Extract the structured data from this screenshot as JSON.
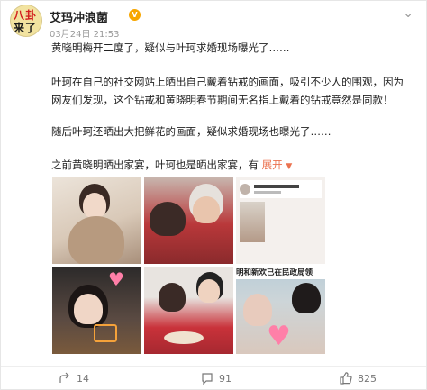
{
  "author": {
    "name": "艾玛冲浪菌",
    "avatar_line1": "八卦",
    "avatar_line2": "来了",
    "date": "03月24日 21:53"
  },
  "post": {
    "p1": "黄晓明梅开二度了，疑似与叶珂求婚现场曝光了……",
    "p2": "叶珂在自己的社交网站上晒出自己戴着钻戒的画面，吸引不少人的围观，因为网友们发现，这个钻戒和黄晓明春节期间无名指上戴着的钻戒竟然是同款！",
    "p3": "随后叶珂还晒出大把鲜花的画面，疑似求婚现场也曝光了……",
    "p4": "之前黄晓明晒出家宴，叶珂也是晒出家宴，有",
    "expand_label": "展开"
  },
  "image6_banner": "明和新欢已在民政局领",
  "actions": {
    "share_count": "14",
    "comment_count": "91",
    "like_count": "825"
  },
  "colors": {
    "accent": "#eb7350",
    "vip": "#f7a600"
  }
}
